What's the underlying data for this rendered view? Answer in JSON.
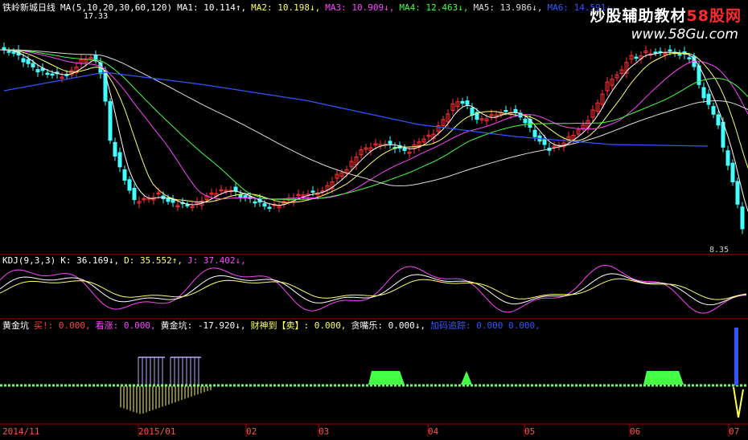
{
  "main": {
    "title": "铁岭新城日线",
    "ma_params": "MA(5,10,20,30,60,120)",
    "ma_values": [
      {
        "label": "MA1:",
        "value": "10.114",
        "arrow": "↑",
        "color": "#ffffff"
      },
      {
        "label": "MA2:",
        "value": "10.198",
        "arrow": "↓",
        "color": "#ffff66"
      },
      {
        "label": "MA3:",
        "value": "10.909",
        "arrow": "↓",
        "color": "#ff44ff"
      },
      {
        "label": "MA4:",
        "value": "12.463",
        "arrow": "↓",
        "color": "#44ff44"
      },
      {
        "label": "MA5:",
        "value": "13.986",
        "arrow": "↓",
        "color": "#dddddd"
      },
      {
        "label": "MA6:",
        "value": "14.591",
        "arrow": "↓",
        "color": "#3355ff"
      }
    ],
    "high_marker": "17.33",
    "low_marker": "8.35"
  },
  "watermark": {
    "text1": "炒股辅助教材",
    "text2": "58股网",
    "url": "www.58Gu.com"
  },
  "kdj": {
    "title": "KDJ(9,3,3)",
    "items": [
      {
        "label": "K:",
        "value": "36.169",
        "arrow": "↓",
        "color": "#ffffff"
      },
      {
        "label": "D:",
        "value": "35.552",
        "arrow": "↑",
        "color": "#ffff66"
      },
      {
        "label": "J:",
        "value": "37.402",
        "arrow": "↓",
        "color": "#ff44ff"
      }
    ]
  },
  "indicator": {
    "title": "黄金坑",
    "items": [
      {
        "label": "买!:",
        "value": "0.000",
        "color": "#ff4444"
      },
      {
        "label": "看涨:",
        "value": "0.000",
        "color": "#ff44ff"
      },
      {
        "label": "黄金坑:",
        "value": "-17.920↓",
        "color": "#ffffff"
      },
      {
        "label": "财神到【卖】:",
        "value": "0.000",
        "color": "#ffff66"
      },
      {
        "label": "贪嘴乐:",
        "value": "0.000↓",
        "color": "#ffffff"
      },
      {
        "label": "加码追踪:",
        "value": "0.000 0.000",
        "color": "#3355ff"
      }
    ]
  },
  "x_axis": [
    "2014/11",
    "2015/01",
    "02",
    "03",
    "04",
    "05",
    "06",
    "07"
  ],
  "colors": {
    "up": "#ff3333",
    "down": "#44ffff",
    "bg": "#000000",
    "panel_border": "#aa0000"
  },
  "chart_data": {
    "type": "candlestick",
    "title": "铁岭新城日线",
    "y_range": [
      8.35,
      17.33
    ],
    "x_labels": [
      "2014/11",
      "2015/01",
      "02",
      "03",
      "04",
      "05",
      "06",
      "07"
    ],
    "price_markers": {
      "high": 17.33,
      "low": 8.35
    },
    "series": [
      {
        "name": "MA1",
        "last": 10.114
      },
      {
        "name": "MA2",
        "last": 10.198
      },
      {
        "name": "MA3",
        "last": 10.909
      },
      {
        "name": "MA4",
        "last": 12.463
      },
      {
        "name": "MA5",
        "last": 13.986
      },
      {
        "name": "MA6",
        "last": 14.591
      },
      {
        "name": "K",
        "last": 36.169
      },
      {
        "name": "D",
        "last": 35.552
      },
      {
        "name": "J",
        "last": 37.402
      }
    ]
  }
}
